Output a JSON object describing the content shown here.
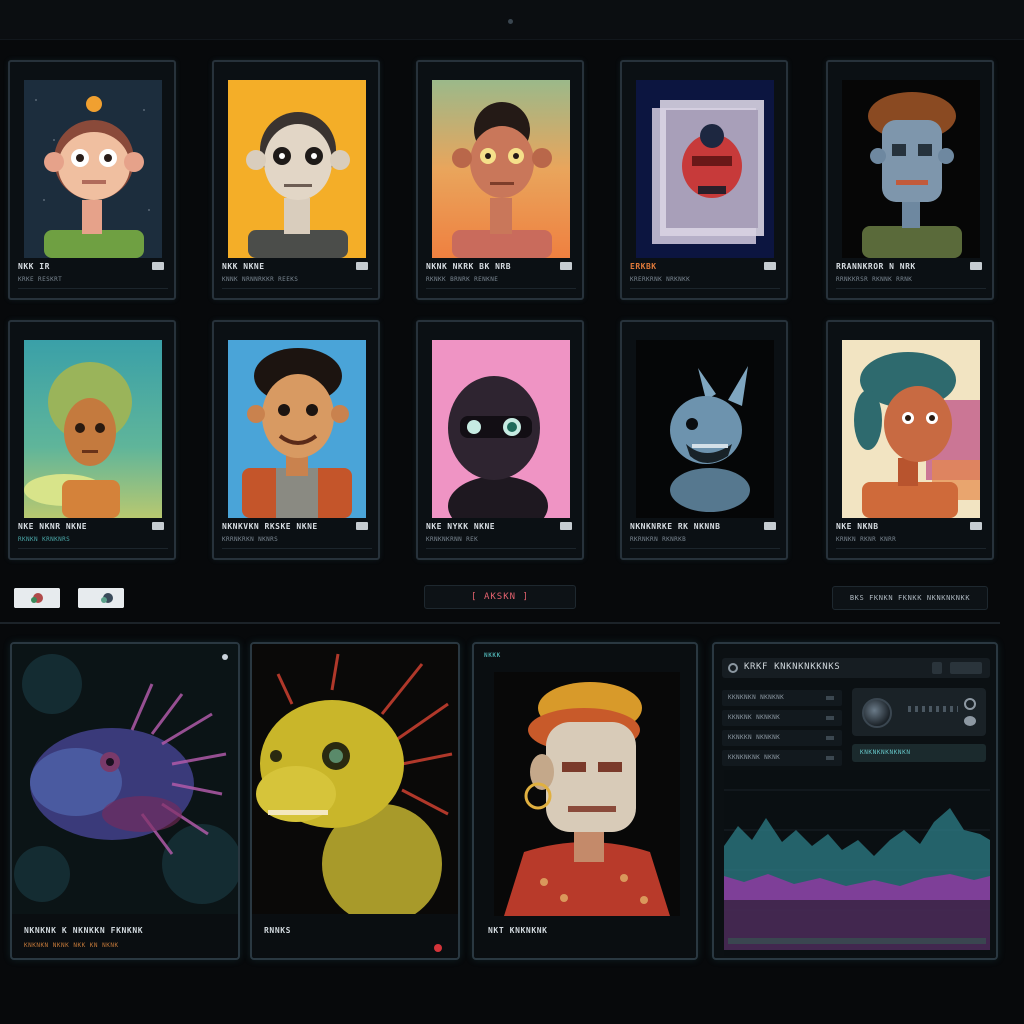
{
  "app": {
    "title": ""
  },
  "grid_cards": [
    {
      "title": "NKK IR",
      "meta": "KRKE RESKRT",
      "badge": ""
    },
    {
      "title": "NKK NKNE",
      "meta": "KNNK NRNNRKKR REEKS",
      "badge": ""
    },
    {
      "title": "NKNK NKRK BK NRB",
      "meta": "RKNKK BRNRK RENKNE",
      "badge": ""
    },
    {
      "title": "ERKBK",
      "meta": "KRERKRNK NRKNKK",
      "badge": ""
    },
    {
      "title": "RRANNKROR N NRK",
      "meta": "RRNKKRSR RKNNK RRNK",
      "badge": ""
    },
    {
      "title": "NKE NKNR NKNE",
      "meta": "RKNKN KRNKNRS",
      "badge": ""
    },
    {
      "title": "NKNKVKN RKSKE NKNE",
      "meta": "KRRNKRKN NKNRS",
      "badge": ""
    },
    {
      "title": "NKE NYKK NKNE",
      "meta": "KRNKNKRNN REK",
      "badge": ""
    },
    {
      "title": "NKNKNRKE RK NKNNB",
      "meta": "RKRNKRN RKNRKB",
      "badge": ""
    },
    {
      "title": "NKE NKNB",
      "meta": "KRNKN RKNR KNRR",
      "badge": ""
    }
  ],
  "toolbar": {
    "center_label": "[ AKSKN ]",
    "right_label": "BKS FKNKN FKNKK NKNKNKNKK"
  },
  "feature_cards": [
    {
      "title": "NKNKNK K NKNKKN FKNKNK",
      "meta": "KNKNKN NKNK NKK KN NKNK"
    },
    {
      "title": "RNNKS",
      "meta": ""
    },
    {
      "title": "NKT  KNKNKNK",
      "meta": "",
      "top_label": "NKKK"
    }
  ],
  "dashboard": {
    "header": "KRKF KNKNKNKKNKS",
    "rows": [
      "KKNKNKN NKNKNK",
      "KKNKNK NKNKNK",
      "KKNKKN NKNKNK",
      "KKNKNKNK NKNK"
    ],
    "teal_button": "KNKNKNKNKNKN"
  },
  "colors": {
    "accent_teal": "#4aa7a8",
    "accent_magenta": "#b04ab8",
    "card_border": "#27323b",
    "background": "#07090b"
  },
  "icons": [
    "gear-icon",
    "knob-icon",
    "toggle-icon"
  ]
}
